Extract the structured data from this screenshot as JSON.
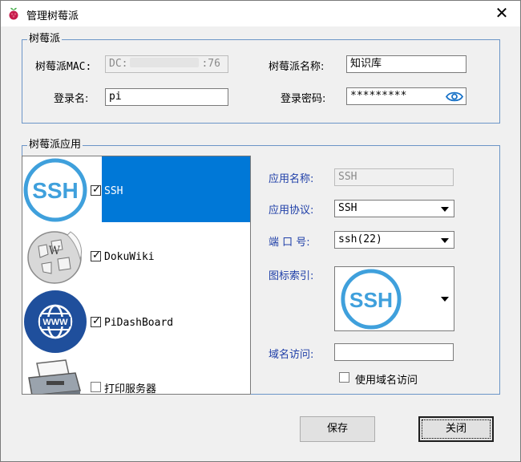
{
  "window": {
    "title": "管理树莓派",
    "close_glyph": "✕"
  },
  "pi_group": {
    "title": "树莓派",
    "mac_label": "树莓派MAC:",
    "mac_prefix": "DC:",
    "mac_suffix": ":76",
    "name_label": "树莓派名称:",
    "name_value": "知识库",
    "login_label": "登录名:",
    "login_value": "pi",
    "password_label": "登录密码:",
    "password_value": "*********"
  },
  "app_group": {
    "title": "树莓派应用",
    "apps": [
      {
        "icon": "ssh-icon",
        "label": "SSH",
        "checked": true,
        "selected": true
      },
      {
        "icon": "wikipedia-globe-icon",
        "label": "DokuWiki",
        "checked": true,
        "selected": false
      },
      {
        "icon": "www-globe-icon",
        "label": "PiDashBoard",
        "checked": true,
        "selected": false
      },
      {
        "icon": "printer-icon",
        "label": "打印服务器",
        "checked": false,
        "selected": false
      }
    ],
    "app_name_label": "应用名称:",
    "app_name_value": "SSH",
    "protocol_label": "应用协议:",
    "protocol_value": "SSH",
    "port_label": "端 口 号:",
    "port_value": "ssh(22)",
    "icon_index_label": "图标索引:",
    "icon_index_value": "SSH",
    "domain_label": "域名访问:",
    "domain_value": "",
    "use_domain_label": "使用域名访问",
    "use_domain_checked": false
  },
  "buttons": {
    "save": "保存",
    "close": "关闭"
  },
  "colors": {
    "accent": "#0078d7",
    "group_border": "#6b95c7",
    "label_blue": "#1f3fa8",
    "ssh_blue": "#3fa0dc"
  }
}
